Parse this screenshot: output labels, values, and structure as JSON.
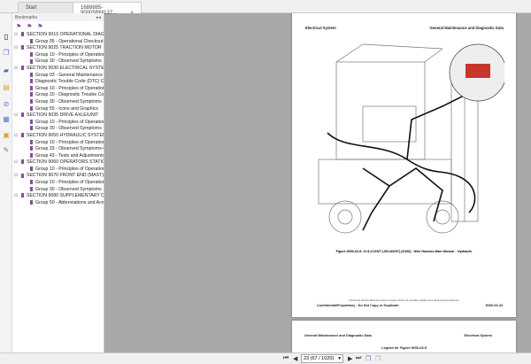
{
  "tabs": [
    {
      "label": "Start"
    },
    {
      "label": "1688885-90005RM137...",
      "close": "×"
    }
  ],
  "bookmarks": {
    "title": "Bookmarks",
    "items": [
      {
        "level": 0,
        "label": "SECTION 9010 OPERATIONAL DIAGN"
      },
      {
        "level": 1,
        "label": "Group 05 - Operational Checkout"
      },
      {
        "level": 0,
        "label": "SECTION 9025 TRACTION MOTOR"
      },
      {
        "level": 1,
        "label": "Group 10 - Principles of Operation"
      },
      {
        "level": 1,
        "label": "Group 30 - Observed Symptoms"
      },
      {
        "level": 0,
        "label": "SECTION 9030 ELECTRICAL SYSTEM"
      },
      {
        "level": 1,
        "label": "Group 03 - General Maintenance a"
      },
      {
        "level": 1,
        "label": "Diagnostic Trouble Code (DTC) Ch"
      },
      {
        "level": 1,
        "label": "Group 10 - Principles of Operation"
      },
      {
        "level": 1,
        "label": "Group 20 - Diagnostic Trouble Cod"
      },
      {
        "level": 1,
        "label": "Group 30 - Observed Symptoms"
      },
      {
        "level": 1,
        "label": "Group 55 - Icons and Graphics"
      },
      {
        "level": 0,
        "label": "SECTION 9035 DRIVE AXLE/UNIT"
      },
      {
        "level": 1,
        "label": "Group 10 - Principles of Operation"
      },
      {
        "level": 1,
        "label": "Group 30 - Observed Symptoms"
      },
      {
        "level": 0,
        "label": "SECTION 9050 HYDRAULIC SYSTEMS"
      },
      {
        "level": 1,
        "label": "Group 10 - Principles of Operation"
      },
      {
        "level": 1,
        "label": "Group 33 - Observed Symptoms-G"
      },
      {
        "level": 1,
        "label": "Group 43 - Tests and Adjustments"
      },
      {
        "level": 0,
        "label": "SECTION 9060 OPERATORS STATION"
      },
      {
        "level": 1,
        "label": "Group 10 - Principles of Operation"
      },
      {
        "level": 0,
        "label": "SECTION 9070 FRONT END (MAST) A"
      },
      {
        "level": 1,
        "label": "Group 10 - Principles of Operation"
      },
      {
        "level": 1,
        "label": "Group 30 - Observed Symptoms"
      },
      {
        "level": 0,
        "label": "SECTION 9080 SUPPLEMENTARY DAT"
      },
      {
        "level": 1,
        "label": "Group 50 - Abbreviations and Acro"
      }
    ]
  },
  "page1": {
    "header_left": "Electrical System",
    "header_right": "General Maintenance and Diagnostic Data",
    "caption": "Figure 9030-03-9: J1.5-2.0XNT (J30-40XNT) (K160) ; Wire Harness Main Manual – Hydraulic",
    "footer_note": "Check the Service Manual section in Hyster Online for possible updates and check pertinent Service",
    "footer_left": "Confidential/Proprietary - Do Not Copy or Duplicate",
    "footer_right": "9030-03-23"
  },
  "page2": {
    "header_left": "General Maintenance and Diagnostic Data",
    "header_right": "Electrical System",
    "legend": "Legend for Figure 9030-03-9"
  },
  "toolbar": {
    "page_value": "23 (67 / 1020)"
  },
  "colors": {
    "bookmark": "#8a4a9c",
    "harness": "#111111"
  }
}
